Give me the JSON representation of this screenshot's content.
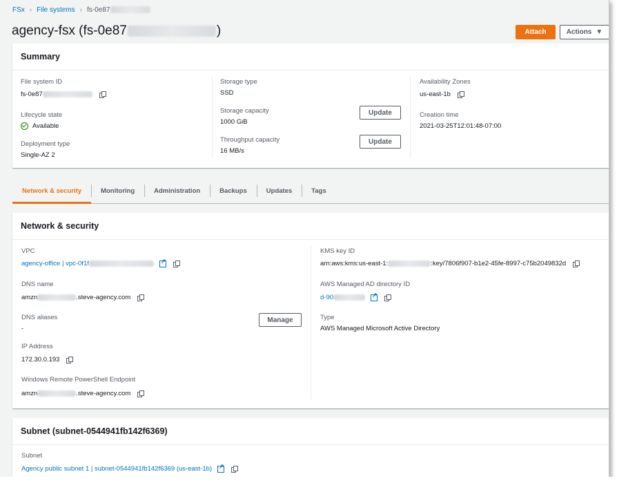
{
  "breadcrumb": {
    "items": [
      "FSx",
      "File systems",
      "fs-0e87"
    ]
  },
  "page": {
    "title": "agency-fsx (fs-0e87",
    "title_suffix": ")"
  },
  "header_actions": {
    "attach": "Attach",
    "actions": "Actions"
  },
  "summary": {
    "heading": "Summary",
    "file_system_id_label": "File system ID",
    "file_system_id": "fs-0e87",
    "lifecycle_label": "Lifecycle state",
    "lifecycle": "Available",
    "deployment_label": "Deployment type",
    "deployment": "Single-AZ 2",
    "storage_type_label": "Storage type",
    "storage_type": "SSD",
    "storage_capacity_label": "Storage capacity",
    "storage_capacity": "1000 GiB",
    "throughput_label": "Throughput capacity",
    "throughput": "16 MB/s",
    "update": "Update",
    "az_label": "Availability Zones",
    "az": "us-east-1b",
    "creation_label": "Creation time",
    "creation": "2021-03-25T12:01:48-07:00"
  },
  "tabs": [
    "Network & security",
    "Monitoring",
    "Administration",
    "Backups",
    "Updates",
    "Tags"
  ],
  "network": {
    "heading": "Network & security",
    "vpc_label": "VPC",
    "vpc_prefix": "agency-office | vpc-0f1f",
    "dns_label": "DNS name",
    "dns_prefix": "amzn",
    "dns_suffix": ".steve-agency.com",
    "aliases_label": "DNS aliases",
    "aliases": "-",
    "manage": "Manage",
    "ip_label": "IP Address",
    "ip": "172.30.0.193",
    "ps_label": "Windows Remote PowerShell Endpoint",
    "ps_prefix": "amzn",
    "ps_suffix": ".steve-agency.com",
    "kms_label": "KMS key ID",
    "kms_prefix": "arn:aws:kms:us-east-1:",
    "kms_suffix": ":key/7806f907-b1e2-45fe-8997-c75b2049832d",
    "ad_label": "AWS Managed AD directory ID",
    "ad_prefix": "d-90",
    "type_label": "Type",
    "type": "AWS Managed Microsoft Active Directory"
  },
  "subnet": {
    "heading": "Subnet (subnet-0544941fb142f6369)",
    "label": "Subnet",
    "value": "Agency public subnet 1 | subnet-0544941fb142f6369 (us-east-1b)"
  }
}
